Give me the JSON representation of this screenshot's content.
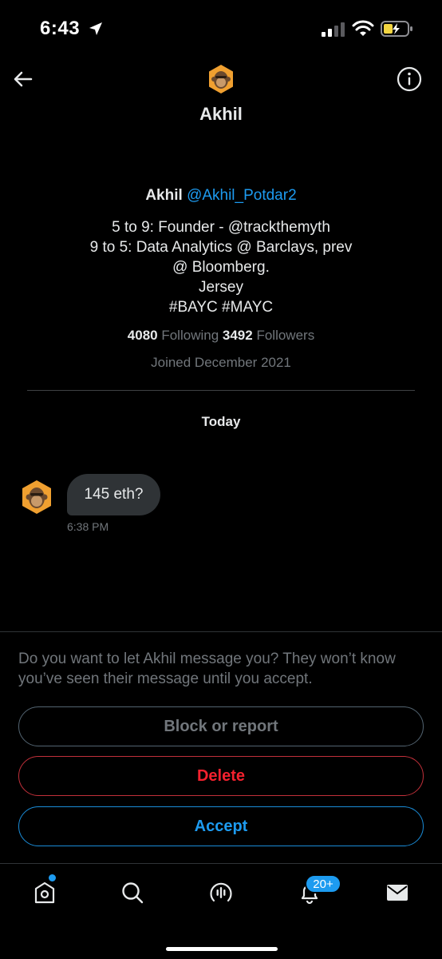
{
  "status_bar": {
    "time": "6:43",
    "icons": [
      "location-arrow-icon",
      "cellular-signal-icon",
      "wifi-icon",
      "battery-charging-icon"
    ]
  },
  "header": {
    "title": "Akhil",
    "back_icon": "arrow-left-icon",
    "info_icon": "info-circle-icon"
  },
  "profile": {
    "name": "Akhil",
    "handle": "@Akhil_Potdar2",
    "bio_lines": [
      "5 to 9: Founder - @trackthemyth",
      "9 to 5: Data Analytics @ Barclays, prev",
      "@ Bloomberg.",
      "Jersey",
      "#BAYC #MAYC"
    ],
    "following_count": "4080",
    "following_label": "Following",
    "followers_count": "3492",
    "followers_label": "Followers",
    "joined": "Joined December 2021"
  },
  "conversation": {
    "day_label": "Today",
    "messages": [
      {
        "text": "145 eth?",
        "time": "6:38 PM"
      }
    ]
  },
  "request": {
    "prompt": "Do you want to let Akhil message you? They won’t know you’ve seen their message until you accept.",
    "block_label": "Block or report",
    "delete_label": "Delete",
    "accept_label": "Accept"
  },
  "tab_bar": {
    "tabs": [
      "home-icon",
      "search-icon",
      "spaces-icon",
      "notifications-icon",
      "messages-icon"
    ],
    "notifications_badge": "20+"
  },
  "colors": {
    "background": "#000000",
    "accent": "#1d9bf0",
    "danger": "#f4212e",
    "muted": "#71767b",
    "avatar_orange": "#f0a030"
  }
}
